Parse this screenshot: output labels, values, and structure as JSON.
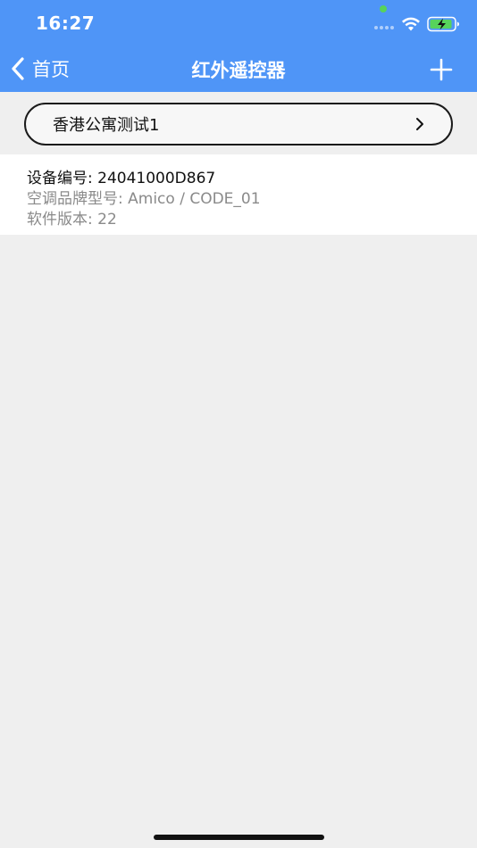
{
  "status_bar": {
    "time": "16:27"
  },
  "nav": {
    "back_label": "首页",
    "title": "红外遥控器"
  },
  "location": {
    "label": "香港公寓测试1"
  },
  "device": {
    "id_line": "设备编号: 24041000D867",
    "brand_line": "空调品牌型号: Amico / CODE_01",
    "version_line": "软件版本: 22"
  },
  "colors": {
    "header_bg": "#4f95f7",
    "page_bg": "#efefef",
    "card_bg": "#ffffff",
    "battery_fill": "#57d35b"
  },
  "icons": {
    "back": "chevron-left-icon",
    "add": "plus-icon",
    "location_chevron": "chevron-right-icon",
    "wifi": "wifi-icon",
    "battery": "battery-charging-icon"
  }
}
